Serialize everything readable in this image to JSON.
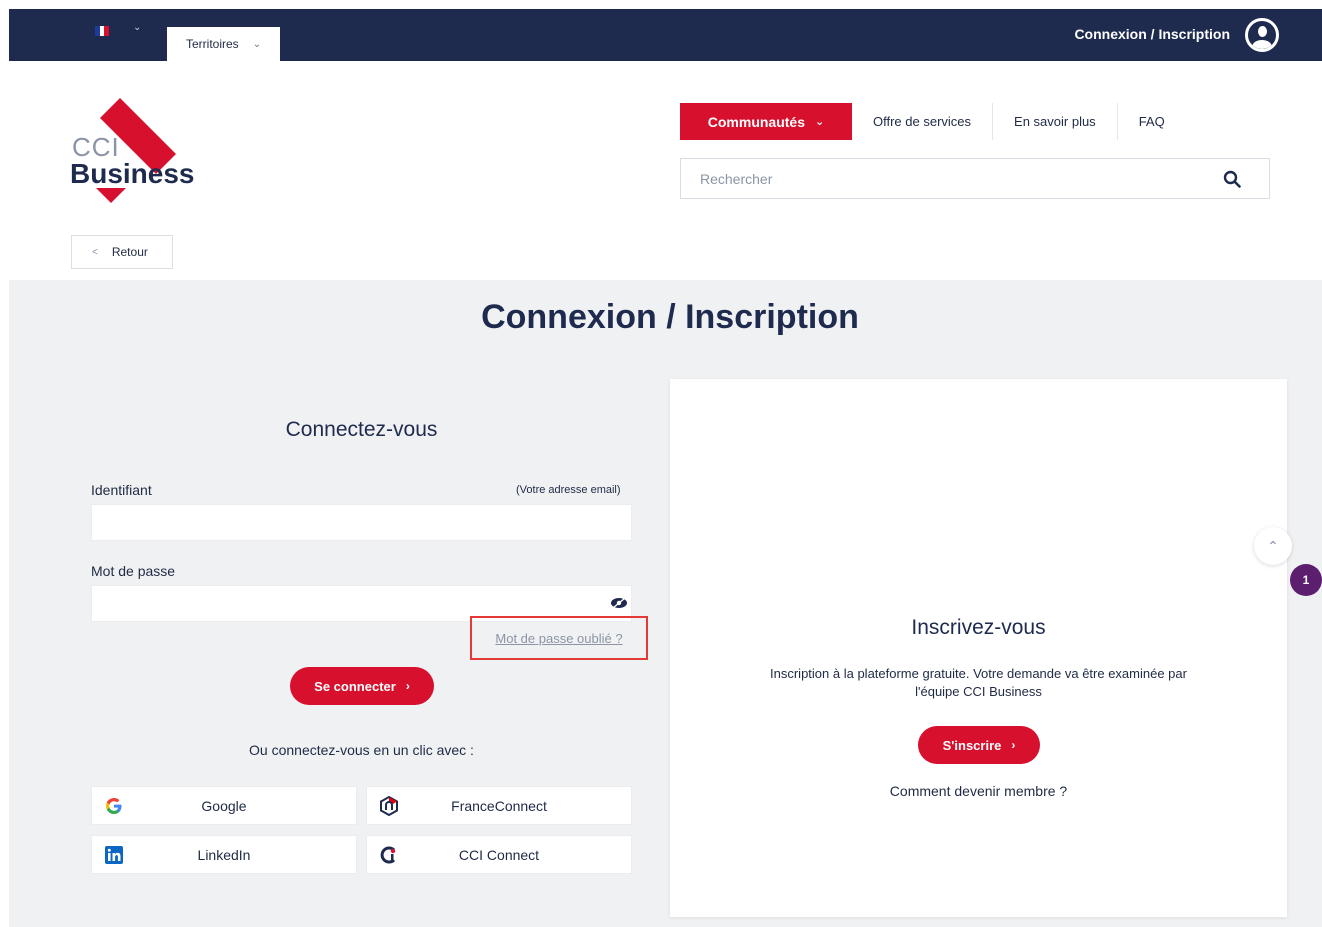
{
  "topbar": {
    "language_flag": "french-flag-icon",
    "territoires_label": "Territoires",
    "login_label": "Connexion / Inscription"
  },
  "header": {
    "logo_cci": "CCI",
    "logo_business": "Business",
    "nav": {
      "communautes": "Communautés",
      "offre": "Offre de services",
      "savoir": "En savoir plus",
      "faq": "FAQ"
    },
    "search": {
      "placeholder": "Rechercher"
    },
    "back_label": "Retour"
  },
  "main": {
    "page_title": "Connexion / Inscription",
    "login": {
      "title": "Connectez-vous",
      "identifier_label": "Identifiant",
      "identifier_hint": "(Votre adresse email)",
      "password_label": "Mot de passe",
      "forgot_password": "Mot de passe oublié ?",
      "submit": "Se connecter",
      "social_title": "Ou connectez-vous en un clic avec :",
      "providers": [
        {
          "label": "Google",
          "icon": "google-icon"
        },
        {
          "label": "FranceConnect",
          "icon": "franceconnect-icon"
        },
        {
          "label": "LinkedIn",
          "icon": "linkedin-icon"
        },
        {
          "label": "CCI Connect",
          "icon": "cci-connect-icon"
        }
      ]
    },
    "register": {
      "title": "Inscrivez-vous",
      "text_line1": "Inscription à la plateforme gratuite. Votre demande va être examinée par",
      "text_line2": "l'équipe CCI Business",
      "submit": "S'inscrire",
      "member_link": "Comment devenir membre ?"
    }
  },
  "floating": {
    "notification_count": "1"
  },
  "colors": {
    "navy": "#1e2b4f",
    "red": "#d6102d",
    "purple": "#5c1e6e",
    "highlight": "#e53935"
  }
}
